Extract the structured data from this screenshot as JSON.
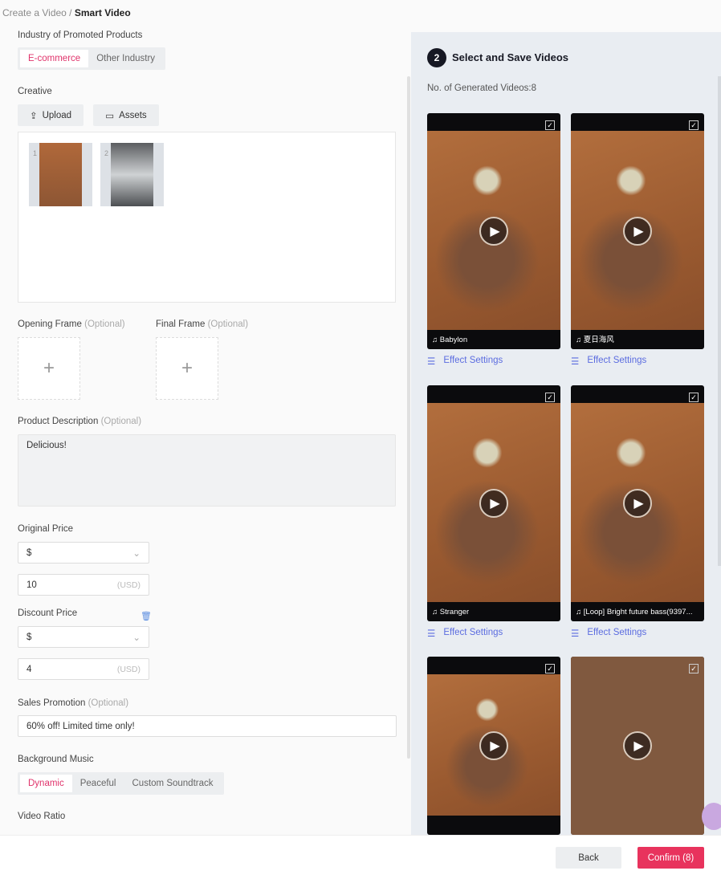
{
  "breadcrumb": {
    "parent": "Create a Video",
    "separator": " / ",
    "current": "Smart Video"
  },
  "form": {
    "industry_label": "Industry of Promoted Products",
    "industry_options": [
      "E-commerce",
      "Other Industry"
    ],
    "creative_label": "Creative",
    "upload_label": "Upload",
    "assets_label": "Assets",
    "creatives": [
      "1",
      "2"
    ],
    "opening_frame_label": "Opening Frame",
    "final_frame_label": "Final Frame",
    "optional": "(Optional)",
    "product_description_label": "Product Description",
    "product_description_value": "Delicious!",
    "original_price_label": "Original Price",
    "currency": "$",
    "original_price": "10",
    "unit": "(USD)",
    "discount_price_label": "Discount Price",
    "discount_price": "4",
    "sales_promotion_label": "Sales Promotion",
    "sales_promotion_value": "60% off! Limited time only!",
    "music_label": "Background Music",
    "music_options": [
      "Dynamic",
      "Peaceful",
      "Custom Soundtrack"
    ],
    "video_ratio_label": "Video Ratio"
  },
  "results": {
    "step": "2",
    "title": "Select and Save Videos",
    "count_text": "No. of Generated Videos:8",
    "effect_label": "Effect Settings",
    "videos": [
      {
        "music": "Babylon"
      },
      {
        "music": "夏日海风"
      },
      {
        "music": "Stranger"
      },
      {
        "music": "[Loop] Bright future bass(9397..."
      },
      {
        "music": ""
      },
      {
        "music": ""
      }
    ]
  },
  "footer": {
    "back": "Back",
    "confirm": "Confirm (8)"
  },
  "colors": {
    "accent": "#e0336b",
    "link": "#5b6ce0",
    "panel": "#e9edf2"
  }
}
